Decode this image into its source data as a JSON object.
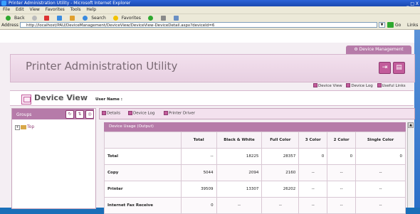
{
  "window": {
    "title": "Printer Administration Utility - Microsoft Internet Explorer",
    "buttons": "_ □ X"
  },
  "menu": [
    "File",
    "Edit",
    "View",
    "Favorites",
    "Tools",
    "Help"
  ],
  "toolbar": {
    "back": "Back",
    "search": "Search",
    "favorites": "Favorites"
  },
  "address": {
    "label": "Address",
    "url": "http://localhost/PAU/DeviceManagement/DeviceView/DeviceView-DeviceDetail.aspx?deviceId=6",
    "go": "Go",
    "links": "Links"
  },
  "header": {
    "device_mgmt_tab": "Device Management",
    "app_title": "Printer Administration Utility"
  },
  "sublinks": {
    "device_view": "Device View",
    "device_log": "Device Log",
    "useful_links": "Useful Links"
  },
  "device_view": {
    "title": "Device View",
    "user_name_label": "User Name :"
  },
  "groups": {
    "label": "Groups",
    "tree_root": "Top"
  },
  "tabs": {
    "details": "Details",
    "device_log": "Device Log",
    "printer_driver": "Printer Driver"
  },
  "usage": {
    "title": "Device Usage (Output)",
    "columns": [
      "",
      "Total",
      "Black & White",
      "Full Color",
      "3 Color",
      "2 Color",
      "Single Color"
    ],
    "rows": [
      [
        "Total",
        "--",
        "18225",
        "28357",
        "0",
        "0",
        "0"
      ],
      [
        "Copy",
        "5044",
        "2094",
        "2160",
        "--",
        "--",
        "--"
      ],
      [
        "Printer",
        "39509",
        "13307",
        "26202",
        "--",
        "--",
        "--"
      ],
      [
        "Internet Fax Receive",
        "0",
        "--",
        "--",
        "--",
        "--",
        "--"
      ]
    ]
  }
}
